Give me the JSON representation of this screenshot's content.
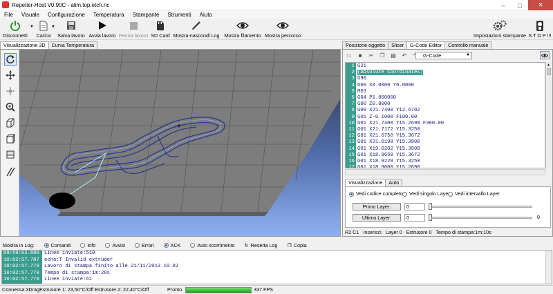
{
  "window": {
    "title": "Repetier-Host V0.90C - alim.top.etch.nc"
  },
  "menu": [
    "File",
    "Visuale",
    "Configurazione",
    "Temperatura",
    "Stampante",
    "Strumenti",
    "Aiuto"
  ],
  "toolbar": {
    "disconnect": "Disconnetti",
    "load": "Carica",
    "save": "Salva lavoro",
    "start": "Avvia lavoro",
    "stop_job": "Ferma lavoro",
    "sdcard": "SD Card",
    "toggle_log": "Mostra-nascondi Log",
    "show_filament": "Mostra filamento",
    "show_path": "Mostra percorso",
    "printer_settings": "Impostazioni stampante",
    "stop": "S T O P !!!"
  },
  "left_tabs": [
    "Visualizzazione 3D",
    "Curva Temperatura"
  ],
  "right_tabs": [
    "Posizione oggetto",
    "Slicer",
    "G-Code Editor",
    "Controllo manuale"
  ],
  "editor": {
    "selector": "G-Code",
    "lines": [
      {
        "n": "1",
        "code": "G21"
      },
      {
        "n": "2",
        "code": "(Absolute Coordinates)",
        "highlight": true
      },
      {
        "n": "3",
        "code": "G90"
      },
      {
        "n": "4",
        "code": "G00 X0.0000 Y0.0000"
      },
      {
        "n": "5",
        "code": "M03"
      },
      {
        "n": "6",
        "code": "G04 P1.000000"
      },
      {
        "n": "7",
        "code": "G00 Z0.8000"
      },
      {
        "n": "8",
        "code": "G00 X21.7400 Y12.6702"
      },
      {
        "n": "9",
        "code": "G01 Z-0.1000 F100.00"
      },
      {
        "n": "10",
        "code": "G01 X21.7400 Y15.2698 F300.00"
      },
      {
        "n": "11",
        "code": "G01 X21.7172 Y15.3250"
      },
      {
        "n": "12",
        "code": "G01 X21.6750 Y15.3672"
      },
      {
        "n": "13",
        "code": "G01 X21.6198 Y15.3900"
      },
      {
        "n": "14",
        "code": "G01 X19.0202 Y15.3900"
      },
      {
        "n": "15",
        "code": "G01 X18.9650 Y15.3672"
      },
      {
        "n": "16",
        "code": "G01 X18.9228 Y15.3250"
      },
      {
        "n": "17",
        "code": "G01 X18.9000 Y15.2698"
      }
    ]
  },
  "view_tabs": [
    "Visualizzazione",
    "Auto"
  ],
  "view_options": {
    "full": "Vedi codice completo",
    "single": "Vedi singolo Layer",
    "range": "Vedi intervallo Layer",
    "first_layer": "Primo Layer:",
    "first_value": "0",
    "last_layer": "Ultimo Layer:",
    "last_value": "0",
    "slider_end": "0"
  },
  "editor_status": {
    "pos": "R2  C1",
    "insert": "Inserisci",
    "layer": "Layer 0",
    "extruder": "Estrusore 0",
    "time": "Tempo di stampa:1m:10s"
  },
  "log": {
    "label": "Mostra in Log:",
    "filters": [
      "Comandi",
      "Info",
      "Avvisi",
      "Errori",
      "ACK",
      "Auto scorrimento"
    ],
    "reset": "Resetta Log",
    "copy": "Copia",
    "rows": [
      {
        "time": "09:59:02.880",
        "msg": "Linee inviate:510"
      },
      {
        "time": "10:02:57.707",
        "msg": "echo:T  Invalid extruder"
      },
      {
        "time": "10:02:57.770",
        "msg": "Lavoro di stampa finito alle 21/11/2013 10.02"
      },
      {
        "time": "10:02:57.770",
        "msg": "Tempo di stampa:1m:28s"
      },
      {
        "time": "10:02:57.770",
        "msg": "Linee inviate:61"
      }
    ]
  },
  "status": {
    "connection": "Connessa:3Drag",
    "extruders": "Estrusore 1: 23,50°C/Off Estrusore 2: 22,40°C/Off",
    "ready": "Pronto",
    "progress_percent": 100,
    "fps": "337 FPS"
  },
  "colors": {
    "accent": "#3a9d8e",
    "stop": "#c74d45",
    "progress": "#1ea01e"
  }
}
